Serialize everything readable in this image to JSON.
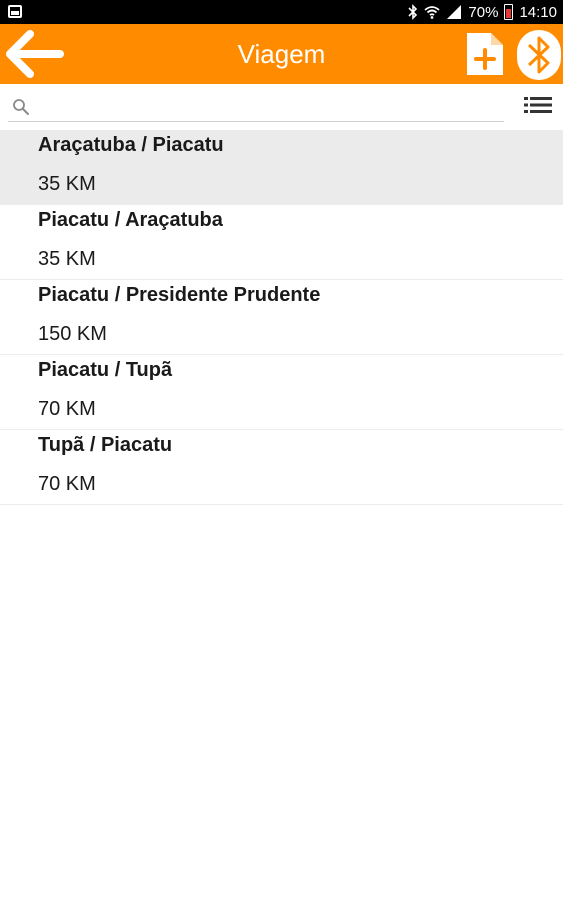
{
  "status_bar": {
    "battery": "70%",
    "time": "14:10",
    "icons": [
      "screenshot-icon",
      "bluetooth-icon",
      "wifi-icon",
      "signal-icon",
      "battery-icon"
    ]
  },
  "action_bar": {
    "title": "Viagem",
    "background": "#ff8c00",
    "icons": [
      "back-arrow-icon",
      "add-document-icon",
      "bluetooth-icon"
    ]
  },
  "search": {
    "value": "",
    "placeholder": ""
  },
  "trips": [
    {
      "route": "Araçatuba / Piacatu",
      "distance": "35 KM",
      "selected": true
    },
    {
      "route": "Piacatu / Araçatuba",
      "distance": "35 KM",
      "selected": false
    },
    {
      "route": "Piacatu / Presidente Prudente",
      "distance": "150 KM",
      "selected": false
    },
    {
      "route": "Piacatu / Tupã",
      "distance": "70 KM",
      "selected": false
    },
    {
      "route": "Tupã / Piacatu",
      "distance": "70 KM",
      "selected": false
    }
  ]
}
